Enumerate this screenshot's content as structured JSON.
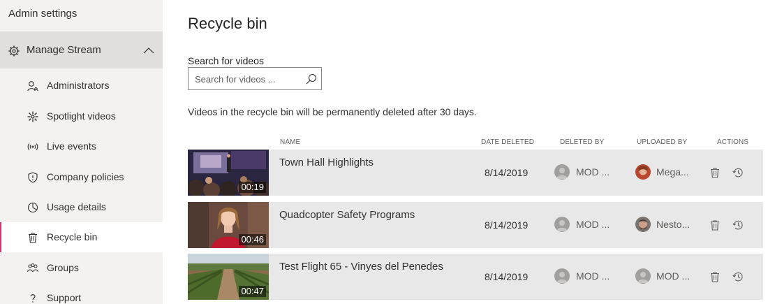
{
  "sidebar": {
    "title": "Admin settings",
    "section": {
      "label": "Manage Stream",
      "icon": "gear-icon",
      "expanded": true
    },
    "items": [
      {
        "label": "Administrators",
        "icon": "admin-person-icon"
      },
      {
        "label": "Spotlight videos",
        "icon": "spotlight-icon"
      },
      {
        "label": "Live events",
        "icon": "live-broadcast-icon"
      },
      {
        "label": "Company policies",
        "icon": "shield-icon"
      },
      {
        "label": "Usage details",
        "icon": "pie-chart-icon"
      },
      {
        "label": "Recycle bin",
        "icon": "trash-icon",
        "active": true
      },
      {
        "label": "Groups",
        "icon": "groups-icon"
      },
      {
        "label": "Support",
        "icon": "question-icon"
      }
    ],
    "accent_color": "#c8386f"
  },
  "main": {
    "title": "Recycle bin",
    "search": {
      "label": "Search for videos",
      "placeholder": "Search for videos ...",
      "value": ""
    },
    "notice": "Videos in the recycle bin will be permanently deleted after 30 days.",
    "columns": {
      "name": "NAME",
      "date_deleted": "DATE DELETED",
      "deleted_by": "DELETED BY",
      "uploaded_by": "UPLOADED BY",
      "actions": "ACTIONS"
    },
    "rows": [
      {
        "title": "Town Hall Highlights",
        "duration": "00:19",
        "date_deleted": "8/14/2019",
        "deleted_by": "MOD ...",
        "uploaded_by": "Mega..."
      },
      {
        "title": "Quadcopter Safety Programs",
        "duration": "00:46",
        "date_deleted": "8/14/2019",
        "deleted_by": "MOD ...",
        "uploaded_by": "Nesto..."
      },
      {
        "title": "Test Flight 65 - Vinyes del Penedes",
        "duration": "00:47",
        "date_deleted": "8/14/2019",
        "deleted_by": "MOD ...",
        "uploaded_by": "MOD ..."
      }
    ]
  }
}
